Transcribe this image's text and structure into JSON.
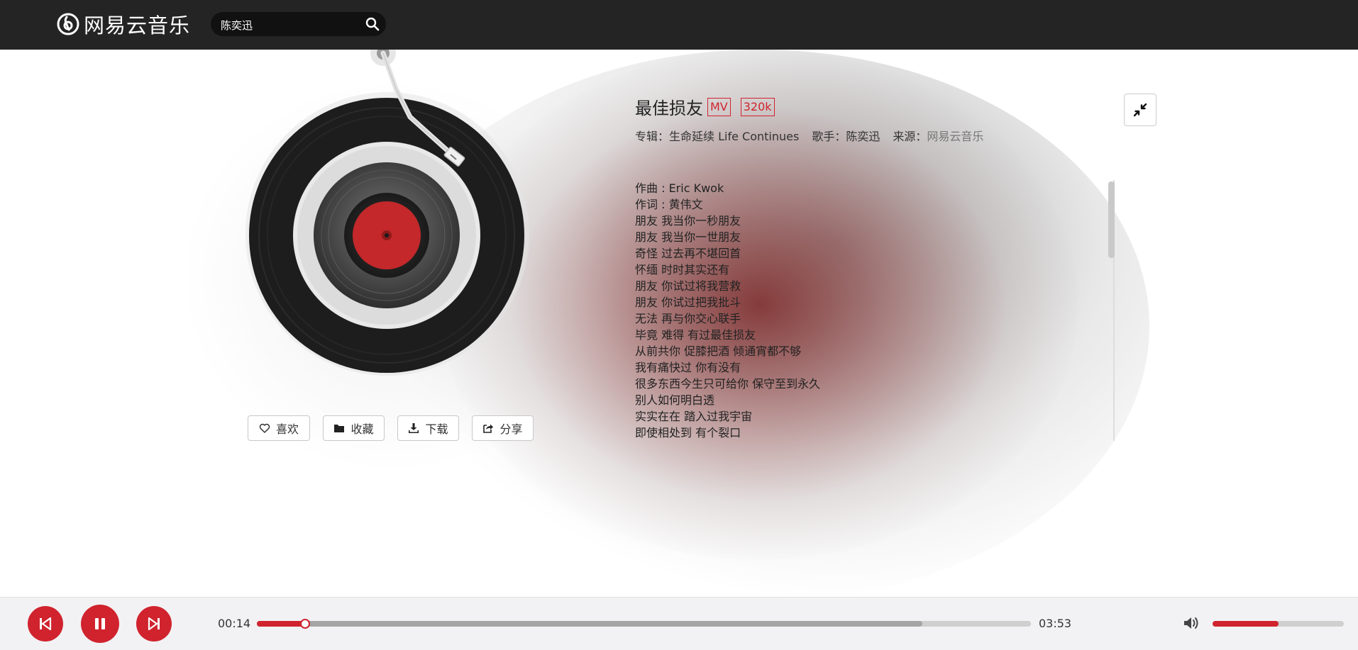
{
  "app": {
    "name": "网易云音乐"
  },
  "search": {
    "value": "陈奕迅",
    "placeholder": ""
  },
  "actions": {
    "like": "喜欢",
    "collect": "收藏",
    "download": "下载",
    "share": "分享"
  },
  "song": {
    "title": "最佳损友",
    "tags": [
      "MV",
      "320k"
    ],
    "album_label": "专辑：",
    "album": "生命延续 Life Continues",
    "artist_label": "歌手：",
    "artist": "陈奕迅",
    "source_label": "来源：",
    "source": "网易云音乐"
  },
  "lyrics": [
    "作曲 : Eric Kwok",
    "作词 : 黄伟文",
    "朋友 我当你一秒朋友",
    "朋友 我当你一世朋友",
    "奇怪 过去再不堪回首",
    "怀缅 时时其实还有",
    "朋友 你试过将我营救",
    "朋友 你试过把我批斗",
    "无法 再与你交心联手",
    "毕竟 难得 有过最佳损友",
    "从前共你 促膝把酒 倾通宵都不够",
    "我有痛快过 你有没有",
    "很多东西今生只可给你 保守至到永久",
    "别人如何明白透",
    "实实在在 踏入过我宇宙",
    "即使相处到 有个裂口"
  ],
  "player": {
    "current_time": "00:14",
    "total_time": "03:53",
    "progress": 0.062,
    "buffered": 0.86,
    "volume": 0.5
  },
  "colors": {
    "accent": "#d0232e",
    "topbar": "#242424"
  },
  "icons": {
    "logo": "netease-logo-icon",
    "search": "search-icon",
    "like": "heart-icon",
    "collect": "folder-icon",
    "download": "download-icon",
    "share": "share-icon",
    "shrink": "compress-icon",
    "prev": "skip-previous-icon",
    "pause": "pause-icon",
    "next": "skip-next-icon",
    "volume": "volume-icon"
  }
}
